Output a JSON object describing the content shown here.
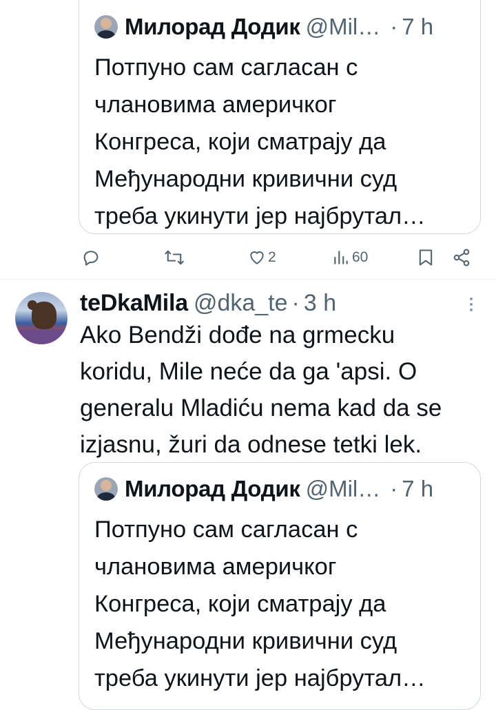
{
  "quoted_tweet_top": {
    "author_name": "Милорад Додик",
    "author_handle": "@Mil…",
    "separator": "·",
    "time": "7 h",
    "text_lines": [
      "Потпуно сам сагласан с",
      "члановима америчког",
      "Конгреса, који сматрају да",
      "Међународни кривични суд",
      "треба укинути јер најбрутал…"
    ]
  },
  "actions": {
    "reply_count": "",
    "retweet_count": "",
    "like_count": "2",
    "views_count": "60"
  },
  "post": {
    "author_name": "teDkaMila",
    "author_handle": "@dka_te",
    "separator": "·",
    "time": "3 h",
    "text_lines": [
      "Ako Bendži dođe na grmecku",
      "koridu, Mile neće da ga 'apsi. O",
      "generalu Mladiću nema kad da se",
      "izjasnu, žuri da odnese tetki lek."
    ]
  },
  "quoted_tweet_bottom": {
    "author_name": "Милорад Додик",
    "author_handle": "@Mil…",
    "separator": "·",
    "time": "7 h",
    "text_lines": [
      "Потпуно сам сагласан с",
      "члановима америчког",
      "Конгреса, који сматрају да",
      "Међународни кривични суд",
      "треба укинути јер најбрутал…"
    ]
  },
  "colors": {
    "text_primary": "#0f1419",
    "text_secondary": "#536471",
    "border": "#cfd9de",
    "divider": "#eff3f4"
  },
  "icons": {
    "reply": "reply-icon",
    "retweet": "retweet-icon",
    "like": "heart-icon",
    "views": "views-chart-icon",
    "bookmark": "bookmark-icon",
    "share": "share-icon",
    "more": "more-vertical-icon"
  }
}
